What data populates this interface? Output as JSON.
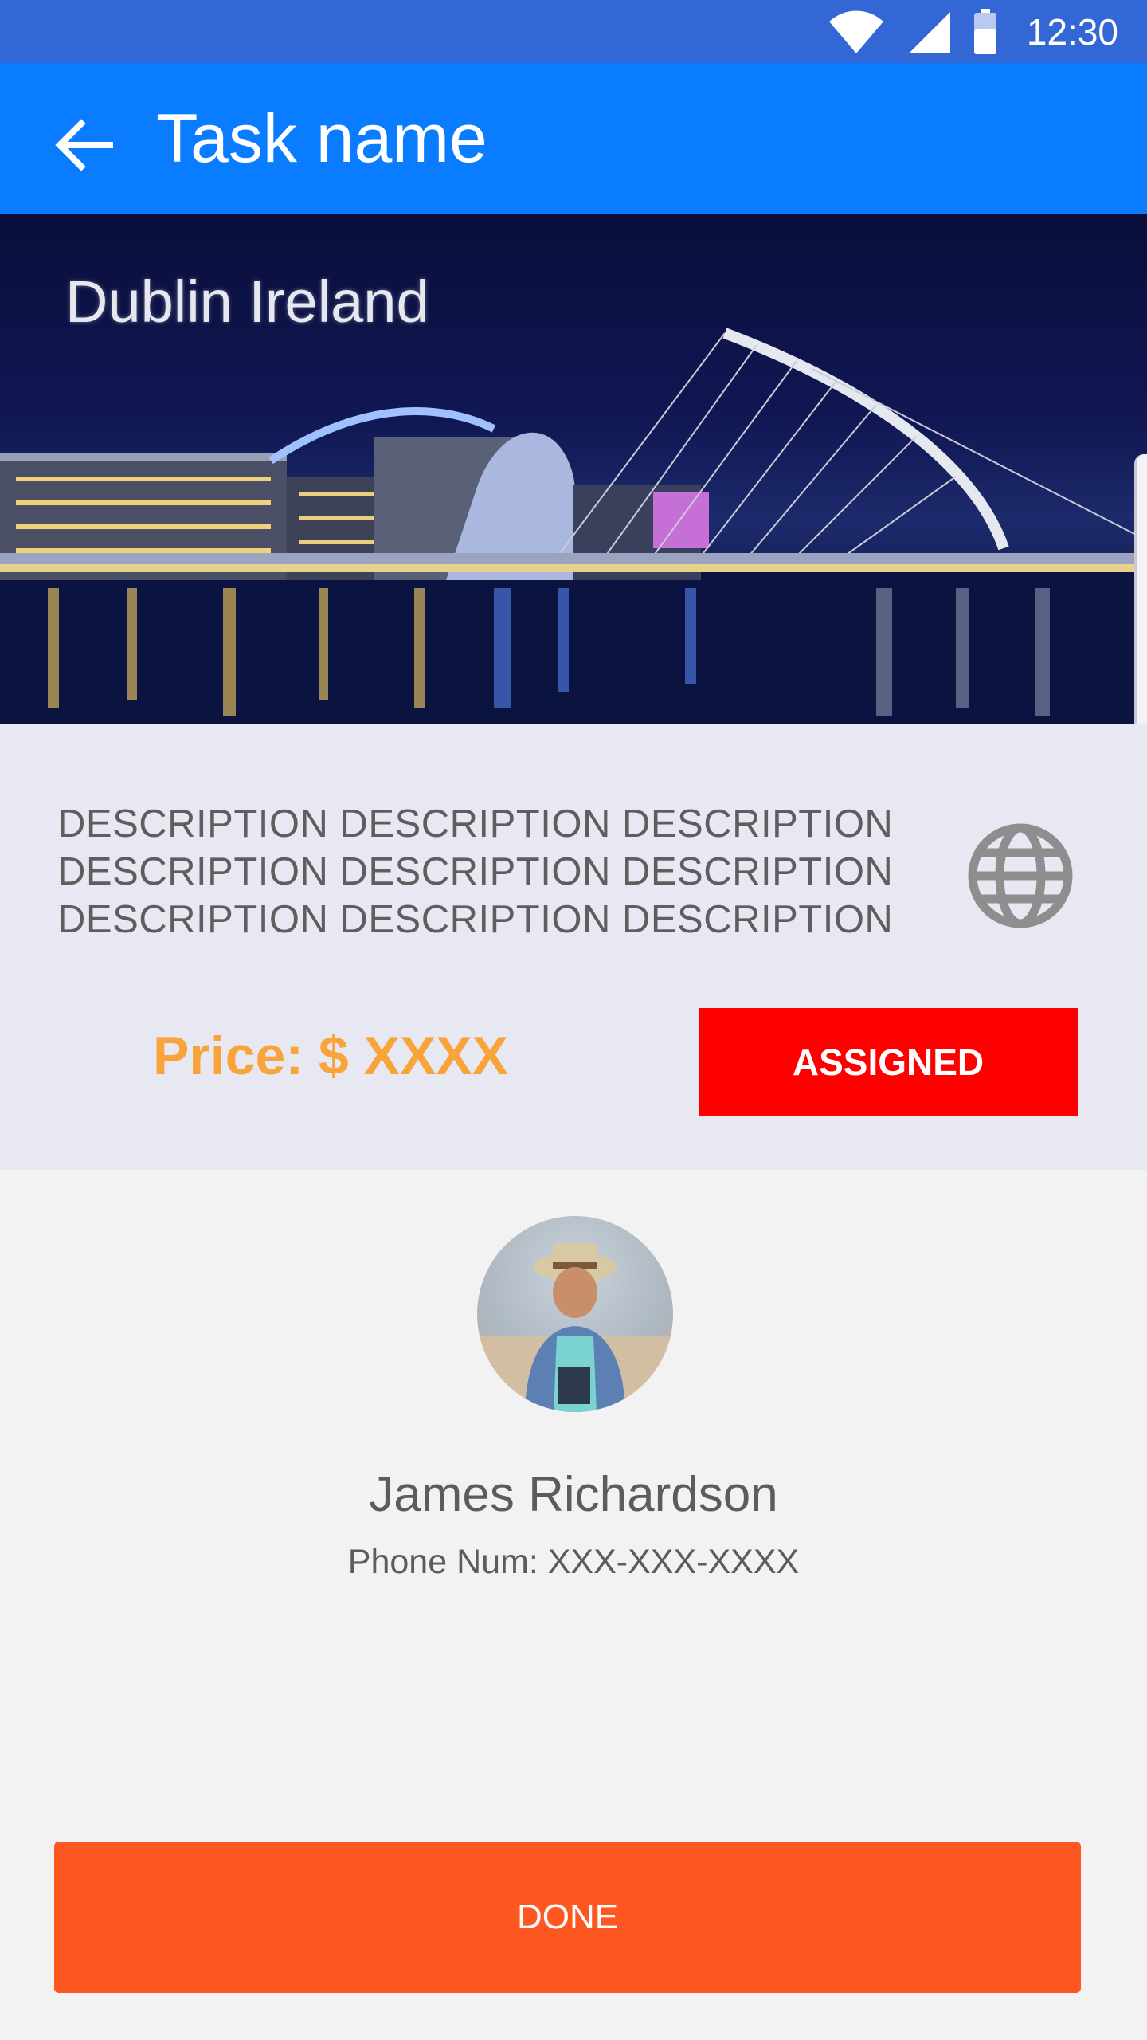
{
  "status_bar": {
    "time": "12:30",
    "icons": [
      "wifi-icon",
      "signal-icon",
      "battery-icon"
    ]
  },
  "app_bar": {
    "back_icon": "arrow-back-icon",
    "title": "Task name"
  },
  "hero": {
    "caption": "Dublin Ireland"
  },
  "task": {
    "description": "DESCRIPTION DESCRIPTION DESCRIPTION DESCRIPTION DESCRIPTION DESCRIPTION DESCRIPTION DESCRIPTION DESCRIPTION",
    "globe_icon": "globe-icon",
    "price": "Price: $ XXXX",
    "status_label": "ASSIGNED"
  },
  "assignee": {
    "name": "James Richardson",
    "phone": "Phone Num: XXX-XXX-XXXX"
  },
  "actions": {
    "done_label": "DONE"
  },
  "colors": {
    "status_bar": "#3367d6",
    "app_bar": "#0a7cff",
    "info_panel": "#e8e8f2",
    "price": "#f9a33b",
    "assigned": "#ff0000",
    "done": "#ff5722"
  }
}
